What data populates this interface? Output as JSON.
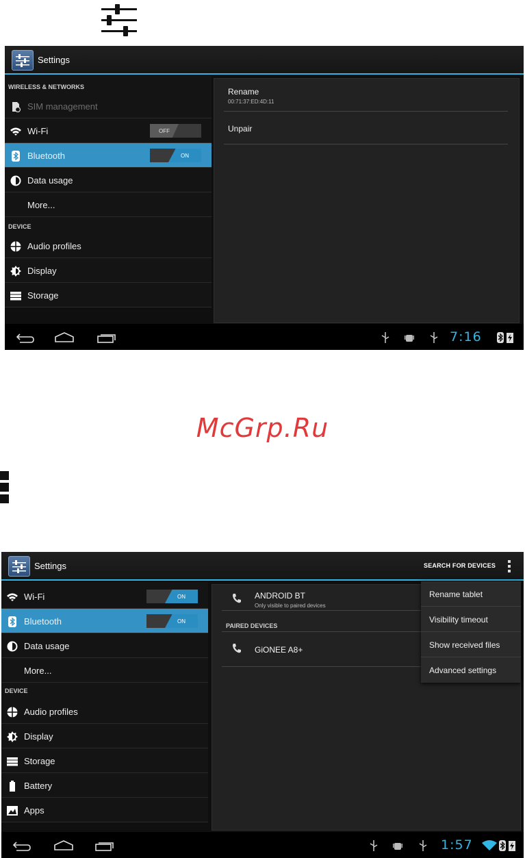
{
  "watermark": "McGrp.Ru",
  "screen1": {
    "app_title": "Settings",
    "sections": {
      "wireless": "WIRELESS & NETWORKS",
      "device": "DEVICE"
    },
    "items": {
      "sim": "SIM management",
      "wifi": "Wi-Fi",
      "wifi_toggle": "OFF",
      "bluetooth": "Bluetooth",
      "bluetooth_toggle": "ON",
      "data_usage": "Data usage",
      "more": "More...",
      "audio": "Audio profiles",
      "display": "Display",
      "storage": "Storage"
    },
    "detail": {
      "rename_title": "Rename",
      "rename_sub": "00:71:37:ED:4D:11",
      "unpair": "Unpair"
    },
    "clock": "7:16"
  },
  "screen2": {
    "app_title": "Settings",
    "search_action": "SEARCH FOR DEVICES",
    "items": {
      "wifi": "Wi-Fi",
      "wifi_toggle": "ON",
      "bluetooth": "Bluetooth",
      "bluetooth_toggle": "ON",
      "data_usage": "Data usage",
      "more": "More...",
      "device_section": "DEVICE",
      "audio": "Audio profiles",
      "display": "Display",
      "storage": "Storage",
      "battery": "Battery",
      "apps": "Apps"
    },
    "detail": {
      "device_name": "ANDROID BT",
      "device_sub": "Only visible to paired devices",
      "paired_header": "PAIRED DEVICES",
      "paired_device": "GiONEE A8+"
    },
    "menu": [
      "Rename tablet",
      "Visibility timeout",
      "Show received files",
      "Advanced settings"
    ],
    "clock": "1:57"
  },
  "colors": {
    "accent": "#33b5e5",
    "selected": "#3592c4",
    "watermark": "#e23a3a"
  }
}
